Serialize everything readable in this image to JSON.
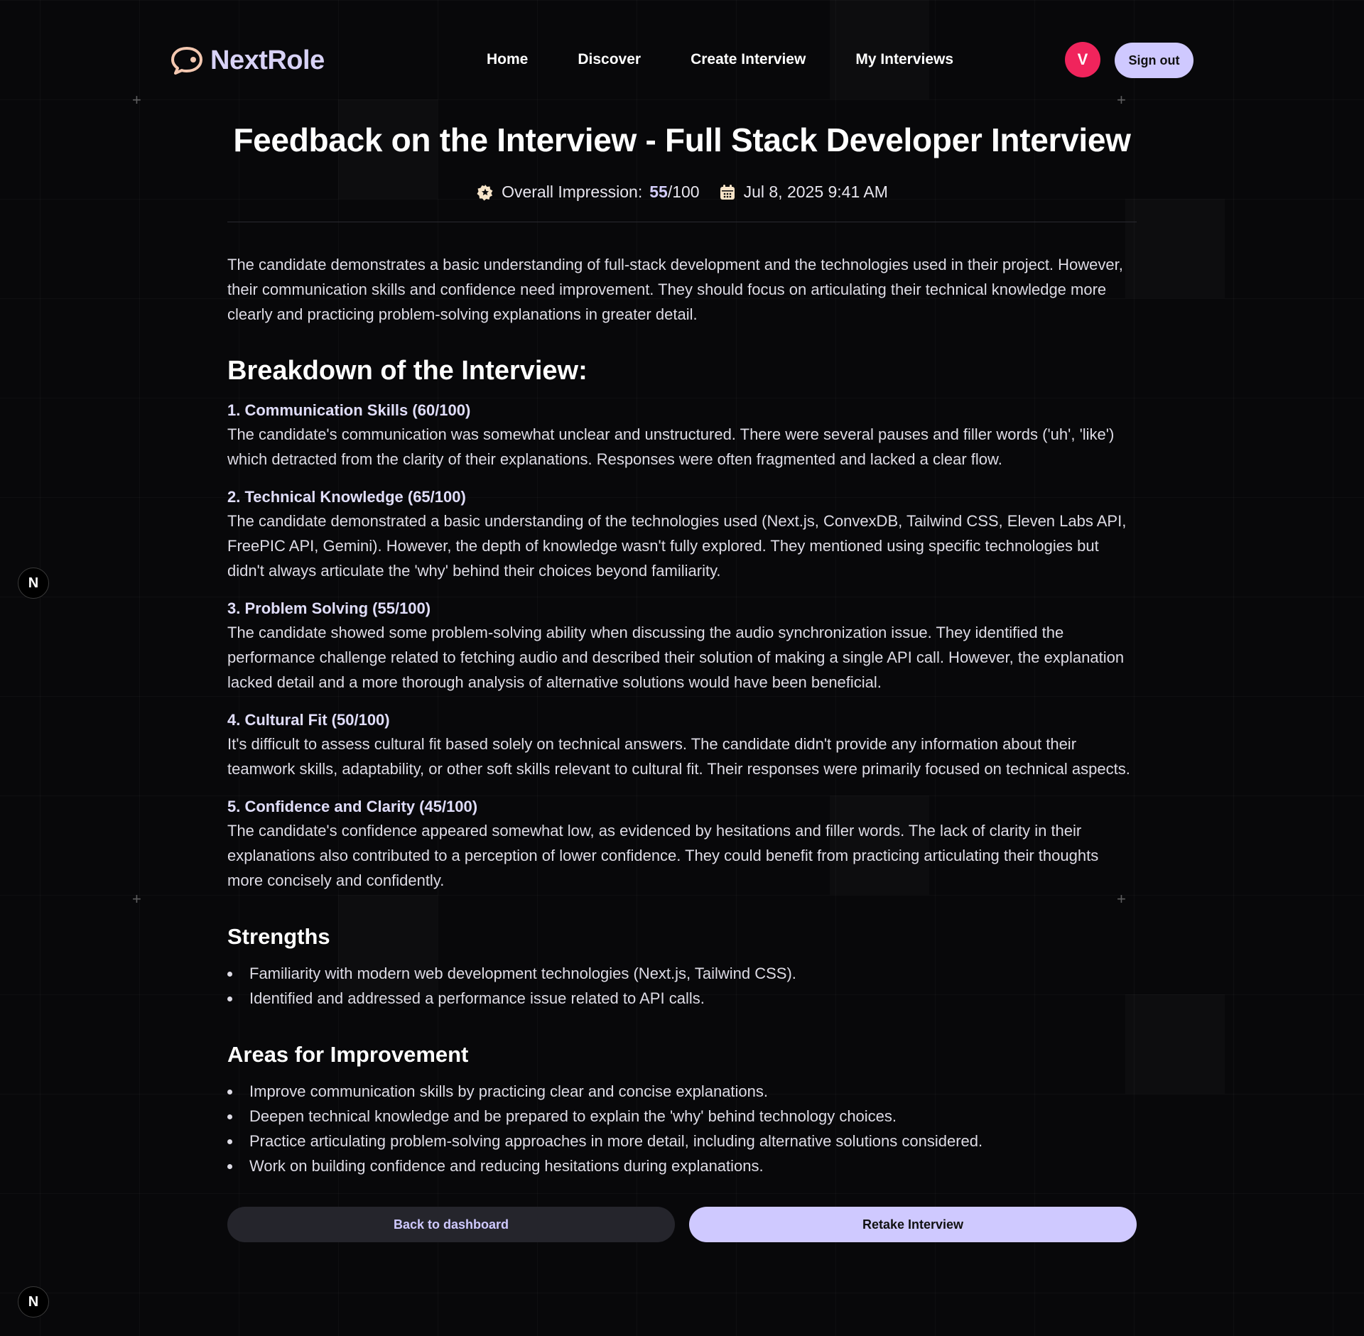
{
  "app": {
    "name": "NextRole"
  },
  "nav": {
    "items": [
      "Home",
      "Discover",
      "Create Interview",
      "My Interviews"
    ]
  },
  "user": {
    "avatar_initial": "V",
    "sign_out_label": "Sign out"
  },
  "page": {
    "title": "Feedback on the Interview - Full Stack Developer Interview",
    "impression_label": "Overall Impression:",
    "score": "55",
    "score_suffix": "/100",
    "date": "Jul 8, 2025 9:41 AM",
    "summary": "The candidate demonstrates a basic understanding of full-stack development and the technologies used in their project. However, their communication skills and confidence need improvement. They should focus on articulating their technical knowledge more clearly and practicing problem-solving explanations in greater detail."
  },
  "breakdown": {
    "heading": "Breakdown of the Interview:",
    "categories": [
      {
        "title": "1. Communication Skills (60/100)",
        "body": "The candidate's communication was somewhat unclear and unstructured. There were several pauses and filler words ('uh', 'like') which detracted from the clarity of their explanations. Responses were often fragmented and lacked a clear flow."
      },
      {
        "title": "2. Technical Knowledge (65/100)",
        "body": "The candidate demonstrated a basic understanding of the technologies used (Next.js, ConvexDB, Tailwind CSS, Eleven Labs API, FreePIC API, Gemini). However, the depth of knowledge wasn't fully explored. They mentioned using specific technologies but didn't always articulate the 'why' behind their choices beyond familiarity."
      },
      {
        "title": "3. Problem Solving (55/100)",
        "body": "The candidate showed some problem-solving ability when discussing the audio synchronization issue. They identified the performance challenge related to fetching audio and described their solution of making a single API call. However, the explanation lacked detail and a more thorough analysis of alternative solutions would have been beneficial."
      },
      {
        "title": "4. Cultural Fit (50/100)",
        "body": "It's difficult to assess cultural fit based solely on technical answers. The candidate didn't provide any information about their teamwork skills, adaptability, or other soft skills relevant to cultural fit. Their responses were primarily focused on technical aspects."
      },
      {
        "title": "5. Confidence and Clarity (45/100)",
        "body": "The candidate's confidence appeared somewhat low, as evidenced by hesitations and filler words. The lack of clarity in their explanations also contributed to a perception of lower confidence. They could benefit from practicing articulating their thoughts more concisely and confidently."
      }
    ]
  },
  "strengths": {
    "heading": "Strengths",
    "items": [
      "Familiarity with modern web development technologies (Next.js, Tailwind CSS).",
      "Identified and addressed a performance issue related to API calls."
    ]
  },
  "improvements": {
    "heading": "Areas for Improvement",
    "items": [
      "Improve communication skills by practicing clear and concise explanations.",
      "Deepen technical knowledge and be prepared to explain the 'why' behind technology choices.",
      "Practice articulating problem-solving approaches in more detail, including alternative solutions considered.",
      "Work on building confidence and reducing hesitations during explanations."
    ]
  },
  "actions": {
    "back_label": "Back to dashboard",
    "retake_label": "Retake Interview"
  },
  "badge": {
    "letter": "N"
  },
  "colors": {
    "accent": "#cfc9ff",
    "avatar": "#f0245c",
    "background": "#08080a"
  },
  "icons": {
    "logo": "chat-bubble-icon",
    "score": "star-badge-icon",
    "date": "calendar-icon"
  }
}
